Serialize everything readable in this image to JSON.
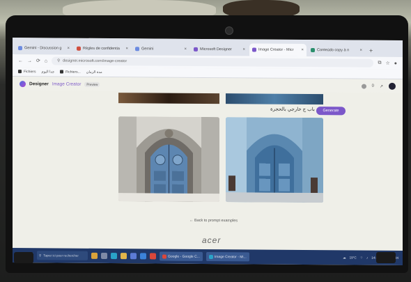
{
  "browser": {
    "tabs": [
      {
        "label": "Gemini - Discussion g",
        "fav": "#6c8be0"
      },
      {
        "label": "Règles de confidentia",
        "fav": "#d14e3e"
      },
      {
        "label": "Gemini",
        "fav": "#6c8be0"
      },
      {
        "label": "Microsoft Designer",
        "fav": "#7b57c9"
      },
      {
        "label": "Image Creator - Micr",
        "fav": "#7b57c9"
      },
      {
        "label": "Conteúdo copy à n",
        "fav": "#2b8f6d"
      }
    ],
    "new_tab": "+",
    "url": "designer.microsoft.com/image-creator",
    "bookmarks": [
      "Fichiers",
      "جدا اليوم",
      "Fichiers...",
      "مدة الزمان"
    ]
  },
  "app": {
    "brand": "Designer",
    "product": "Image Creator",
    "badge": "Preview",
    "coins": "0"
  },
  "prompt": {
    "text": "باب ج خارجي بالحجرة",
    "generate_label": "Generate"
  },
  "back_link": "← Back to prompt examples",
  "taskbar": {
    "search_placeholder": "Tapez ici pour rechercher",
    "buttons": [
      "Google - Google C...",
      "Image Creator - Mi..."
    ],
    "weather": "19°C",
    "time": "14:31",
    "date": "05/04/2024"
  },
  "laptop_brand": "acer",
  "colors": {
    "accent": "#7b57c9",
    "taskbar": "#203868"
  }
}
